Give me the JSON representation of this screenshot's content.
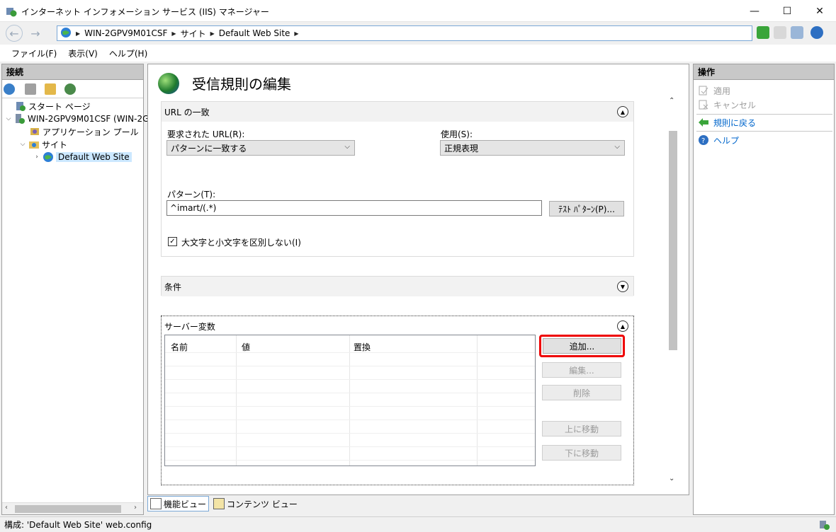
{
  "window": {
    "title": "インターネット インフォメーション サービス (IIS) マネージャー",
    "min": "—",
    "max": "☐",
    "close": "✕"
  },
  "address": {
    "crumbs": [
      "WIN-2GPV9M01CSF",
      "サイト",
      "Default Web Site"
    ]
  },
  "menu": [
    "ファイル(F)",
    "表示(V)",
    "ヘルプ(H)"
  ],
  "left": {
    "title": "接続",
    "tree": [
      {
        "label": "スタート ページ"
      },
      {
        "label": "WIN-2GPV9M01CSF (WIN-2GI"
      },
      {
        "label": "アプリケーション プール"
      },
      {
        "label": "サイト"
      },
      {
        "label": "Default Web Site"
      }
    ]
  },
  "center": {
    "title": "受信規則の編集",
    "url_section": {
      "title": "URL の一致",
      "requested_url_label": "要求された URL(R):",
      "requested_url_value": "パターンに一致する",
      "using_label": "使用(S):",
      "using_value": "正規表現",
      "pattern_label": "パターン(T):",
      "pattern_value": "^imart/(.*)",
      "test_button": "ﾃｽﾄ ﾊﾟﾀｰﾝ(P)...",
      "ignore_case_label": "大文字と小文字を区別しない(I)",
      "ignore_case_checked": true
    },
    "conditions_section": {
      "title": "条件"
    },
    "server_vars_section": {
      "title": "サーバー変数",
      "columns": [
        "名前",
        "値",
        "置換"
      ],
      "buttons": {
        "add": "追加...",
        "edit": "編集...",
        "delete": "削除",
        "move_up": "上に移動",
        "move_down": "下に移動"
      }
    }
  },
  "view_tabs": {
    "features": "機能ビュー",
    "content": "コンテンツ ビュー"
  },
  "right": {
    "title": "操作",
    "apply": "適用",
    "cancel": "キャンセル",
    "back": "規則に戻る",
    "help": "ヘルプ"
  },
  "status": {
    "text": "構成: 'Default Web Site' web.config"
  },
  "colors": {
    "highlight": "#e00000",
    "link": "#0066cc"
  }
}
